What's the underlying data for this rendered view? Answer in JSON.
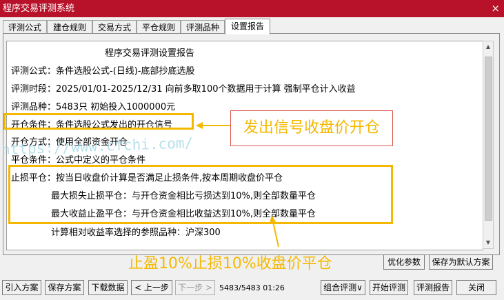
{
  "window": {
    "title": "程序交易评测系统",
    "close_label": "×"
  },
  "tabs": [
    {
      "label": "评测公式",
      "active": false
    },
    {
      "label": "建仓规则",
      "active": false
    },
    {
      "label": "交易方式",
      "active": false
    },
    {
      "label": "平仓规则",
      "active": false
    },
    {
      "label": "评测品种",
      "active": false
    },
    {
      "label": "设置报告",
      "active": true
    }
  ],
  "report": {
    "heading": "程序交易评测设置报告",
    "lines": [
      "评测公式：条件选股公式-(日线)-底部抄底选股",
      "评测时段：2025/01/01-2025/12/31 向前多取100个数据用于计算 强制平仓计入收益",
      "评测品种：5483只 初始投入1000000元",
      "开仓条件：条件选股公式发出的开仓信号",
      "开仓方式：使用全部资金开仓",
      "平仓条件：公式中定义的平仓条件",
      "止损平仓：按当日收盘价计算是否满足止损条件,按本周期收盘价平仓",
      "最大损失止损平仓：与开仓资金相比亏损达到10%,则全部数量平仓",
      "最大收益止盈平仓：与开仓资金相比收益达到10%,则全部数量平仓",
      "计算相对收益率选择的参照品种：沪深300"
    ]
  },
  "annotations": {
    "callout1": "发出信号收盘价开仓",
    "callout2": "止盈10%止损10%收盘价平仓",
    "watermark": "https://www.cfchi.com/",
    "accent_color": "#f5b800"
  },
  "panel_buttons": {
    "optimize": "优化参数",
    "save_default": "保存为默认方案"
  },
  "bottom_bar": {
    "import": "引入方案",
    "save": "保存方案",
    "download": "下载数据",
    "prev": "< 上一步",
    "next": "下一步 >",
    "progress": "5483/5483 01:26",
    "combo_eval": "组合评测",
    "start_eval": "开始评测",
    "eval_report": "评测报告",
    "close": "关闭"
  }
}
